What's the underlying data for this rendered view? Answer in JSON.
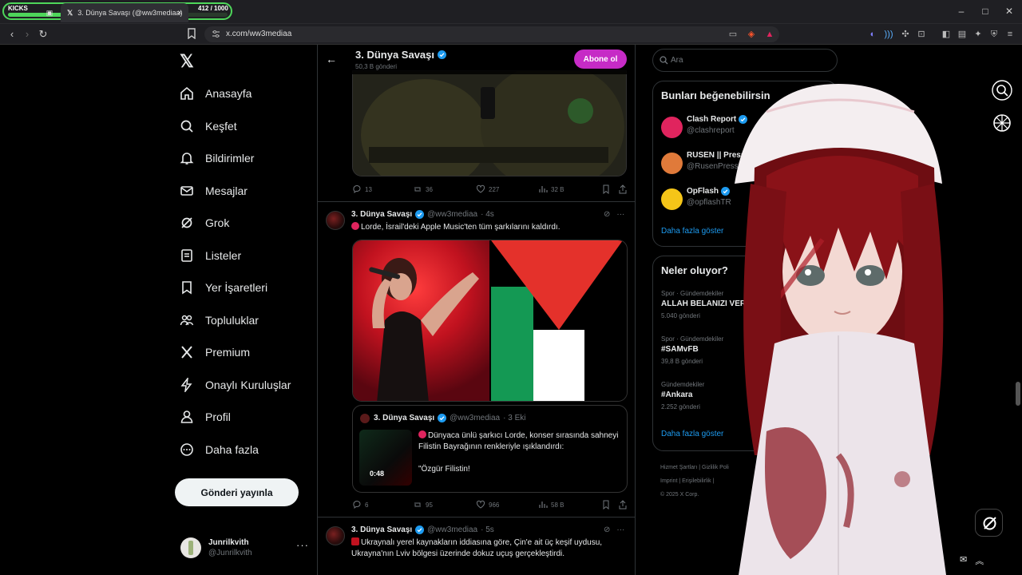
{
  "overlay": {
    "kicks_label": "KICKS",
    "kicks_count": "412  / 1000",
    "kicks_progress": 0.412
  },
  "browser": {
    "tab_title": "3. Dünya Savaşı (@ww3mediaa)",
    "tab_close": "×",
    "url": "x.com/ww3mediaa",
    "window_controls": [
      "–",
      "□",
      "✕"
    ]
  },
  "nav": {
    "logo": "𝕏",
    "items": [
      {
        "label": "Anasayfa",
        "icon": "home-icon"
      },
      {
        "label": "Keşfet",
        "icon": "search-icon"
      },
      {
        "label": "Bildirimler",
        "icon": "bell-icon"
      },
      {
        "label": "Mesajlar",
        "icon": "mail-icon"
      },
      {
        "label": "Grok",
        "icon": "grok-icon"
      },
      {
        "label": "Listeler",
        "icon": "list-icon"
      },
      {
        "label": "Yer İşaretleri",
        "icon": "bookmark-icon"
      },
      {
        "label": "Topluluklar",
        "icon": "community-icon"
      },
      {
        "label": "Premium",
        "icon": "x-icon"
      },
      {
        "label": "Onaylı Kuruluşlar",
        "icon": "lightning-icon"
      },
      {
        "label": "Profil",
        "icon": "person-icon"
      },
      {
        "label": "Daha fazla",
        "icon": "more-circle-icon"
      }
    ],
    "post_button": "Gönderi yayınla",
    "account": {
      "name": "Junrilkvith",
      "handle": "@Junrilkvith",
      "more": "···"
    }
  },
  "header": {
    "title": "3. Dünya Savaşı",
    "subtitle": "50,3 B gönderi",
    "subscribe": "Abone ol",
    "back": "←"
  },
  "tweets": [
    {
      "replies": "13",
      "retweets": "36",
      "likes": "227",
      "views": "32 B"
    },
    {
      "name": "3. Dünya Savaşı",
      "handle": "@ww3mediaa",
      "time": "· 4s",
      "text": "Lorde, İsrail'deki Apple Music'ten tüm şarkılarını kaldırdı.",
      "quote": {
        "name": "3. Dünya Savaşı",
        "handle": "@ww3mediaa",
        "time": "· 3 Eki",
        "line1": "Dünyaca ünlü şarkıcı Lorde, konser sırasında sahneyi Filistin Bayrağının renkleriyle ışıklandırdı:",
        "line2": "\"Özgür Filistin!",
        "duration": "0:48"
      },
      "replies": "6",
      "retweets": "95",
      "likes": "966",
      "views": "58 B"
    },
    {
      "name": "3. Dünya Savaşı",
      "handle": "@ww3mediaa",
      "time": "· 5s",
      "text": "Ukraynalı yerel kaynakların iddiasına göre, Çin'e ait üç keşif uydusu, Ukrayna'nın Lviv bölgesi üzerinde dokuz uçuş gerçekleştirdi."
    }
  ],
  "search": {
    "placeholder": "Ara"
  },
  "suggestions": {
    "title": "Bunları beğenebilirsin",
    "items": [
      {
        "name": "Clash Report",
        "handle": "@clashreport",
        "color": "#e0245e"
      },
      {
        "name": "RUSEN || Press",
        "handle": "@RusenPress",
        "color": "#e07a3a"
      },
      {
        "name": "OpFlash",
        "handle": "@opflashTR",
        "color": "#f5c518"
      }
    ],
    "show_more": "Daha fazla göster"
  },
  "trends": {
    "title": "Neler oluyor?",
    "items": [
      {
        "category": "Spor · Gündemdekiler",
        "title": "ALLAH BELANIZI VERSİ",
        "count": "5.040 gönderi"
      },
      {
        "category": "Spor · Gündemdekiler",
        "title": "#SAMvFB",
        "count": "39,8 B gönderi"
      },
      {
        "category": "Gündemdekiler",
        "title": "#Ankara",
        "count": "2.252 gönderi"
      }
    ],
    "show_more": "Daha fazla göster"
  },
  "footer": {
    "line1": "Hizmet Şartları  |  Gizlilik Poli",
    "line2": "Imprint  |  Erişilebilirlik  |",
    "line3": "© 2025 X Corp."
  },
  "colors": {
    "accent": "#1d9bf0",
    "subscribe": "#c62bc6",
    "background": "#000000"
  }
}
